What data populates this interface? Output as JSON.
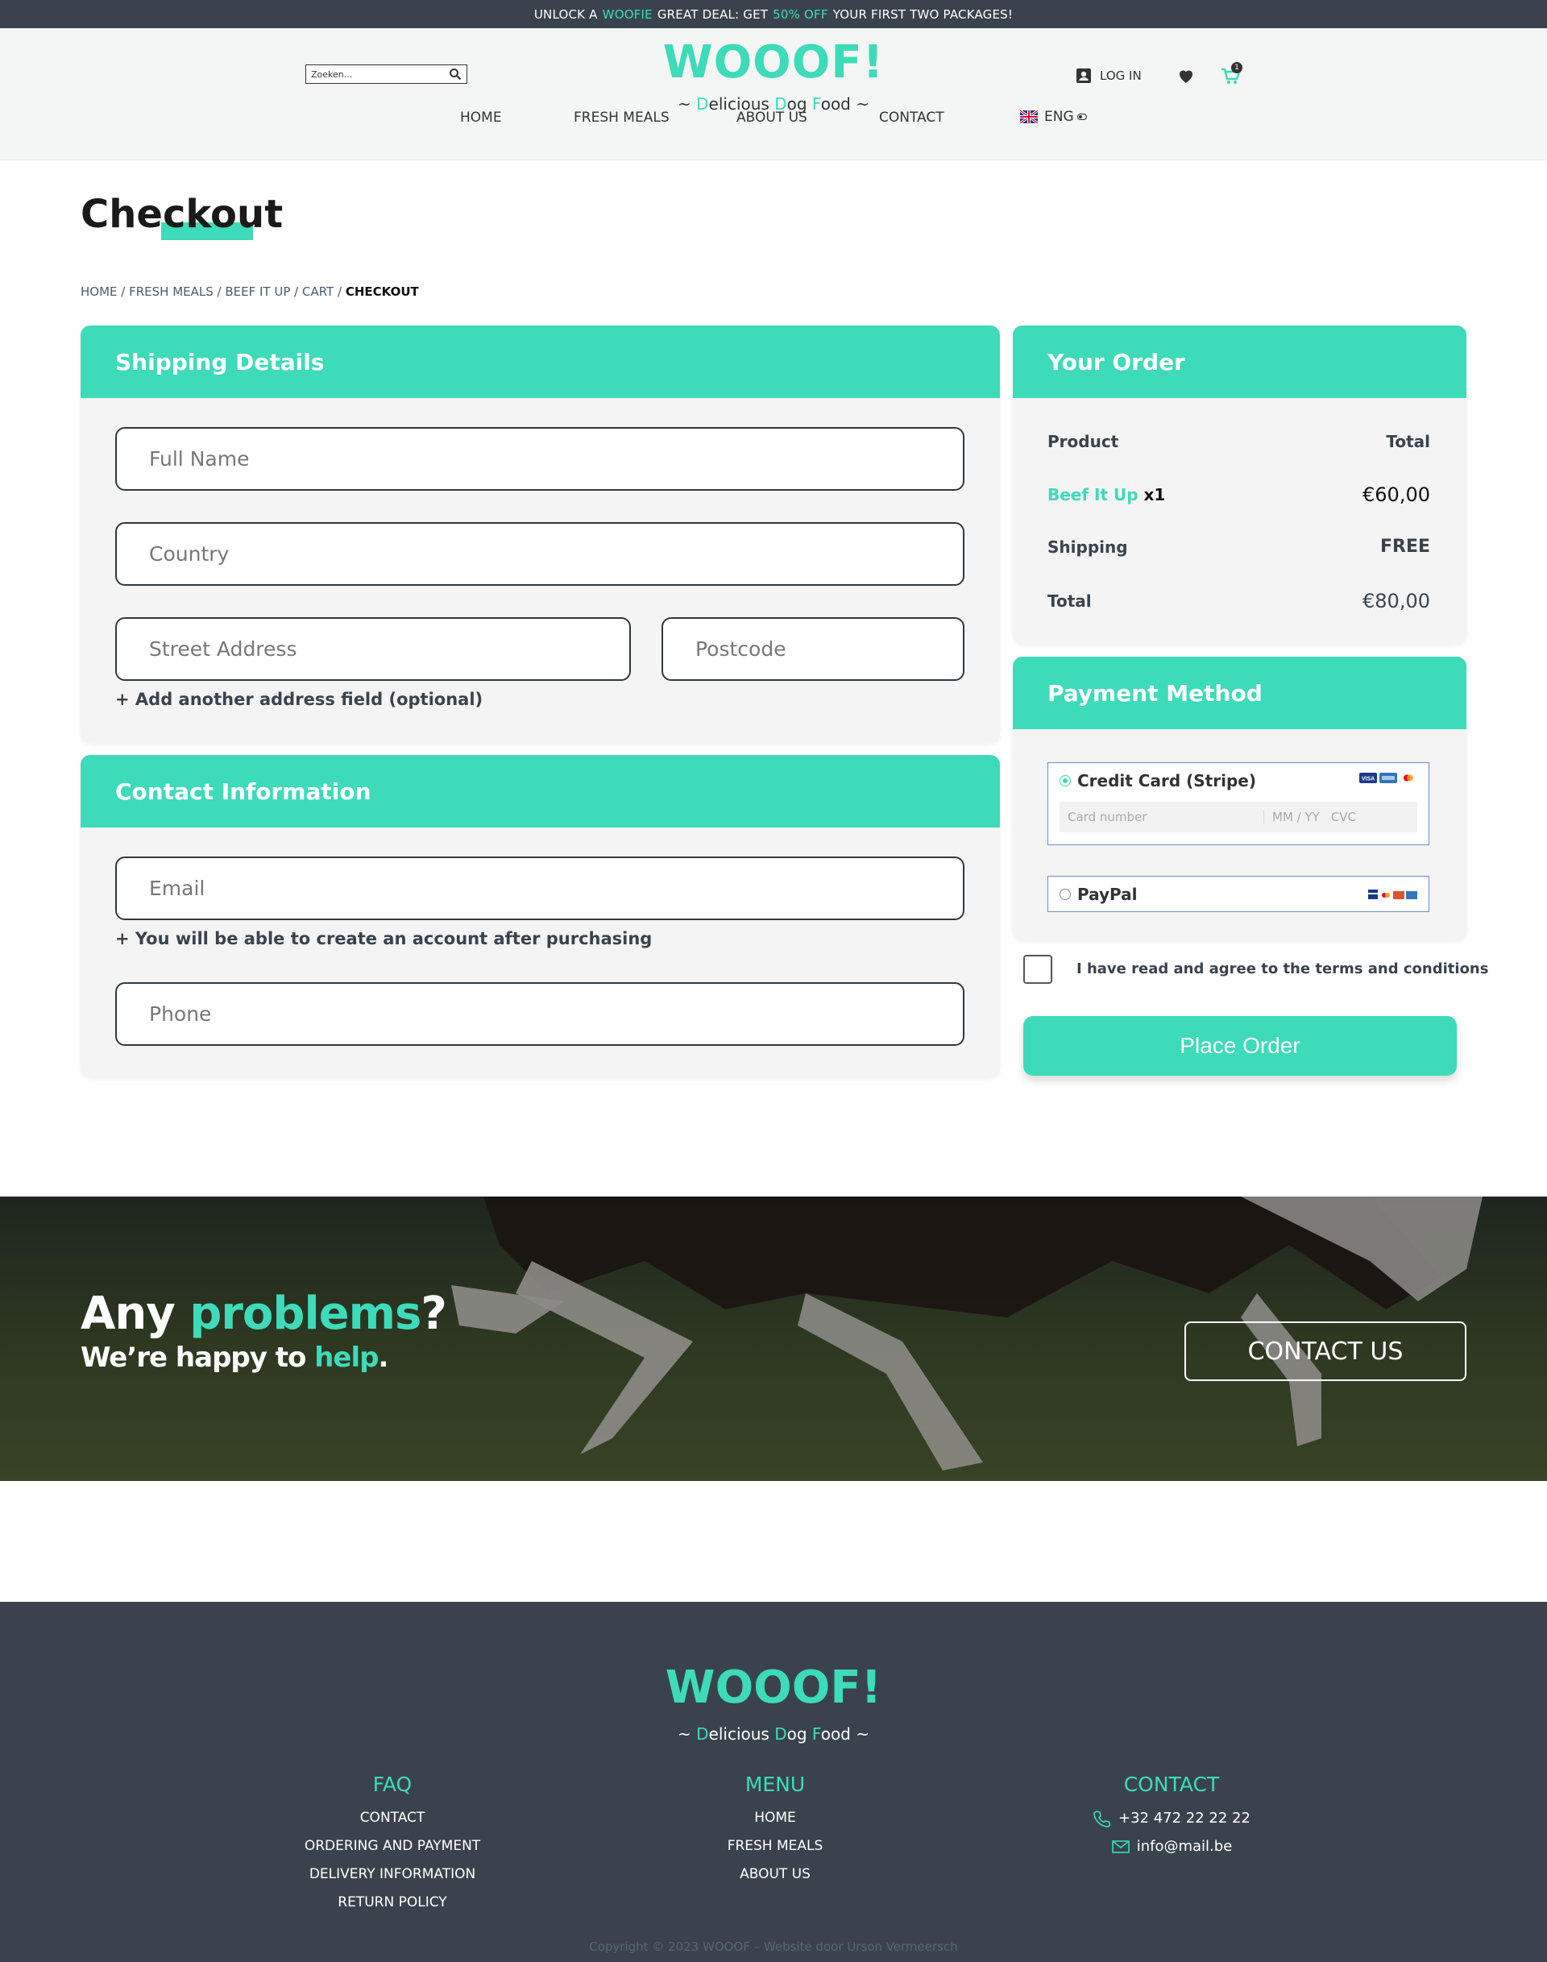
{
  "promo": {
    "part1": "UNLOCK A",
    "part2": "WOOFIE",
    "part3": "GREAT DEAL: GET",
    "part4": "50% OFF",
    "part5": "YOUR FIRST TWO PACKAGES!"
  },
  "header": {
    "logo": "WOOOF!",
    "tagline_parts": [
      "~ ",
      "D",
      "elicious ",
      "D",
      "og ",
      "F",
      "ood ~"
    ],
    "search_placeholder": "Zoeken...",
    "login": "LOG IN",
    "cart_count": "1",
    "lang": "ENG"
  },
  "nav": {
    "items": [
      "HOME",
      "FRESH MEALS",
      "ABOUT US",
      "CONTACT"
    ]
  },
  "page": {
    "title": "Checkout",
    "breadcrumb": [
      "HOME",
      "FRESH MEALS",
      "BEEF IT UP",
      "CART",
      "CHECKOUT"
    ]
  },
  "shipping": {
    "heading": "Shipping Details",
    "full_name": "Full Name",
    "country": "Country",
    "street": "Street Address",
    "postcode": "Postcode",
    "add_field": "+ Add another address field (optional)"
  },
  "contact_info": {
    "heading": "Contact Information",
    "email": "Email",
    "account_hint": "+ You will be able to create an account after purchasing",
    "phone": "Phone"
  },
  "order": {
    "heading": "Your Order",
    "col_product": "Product",
    "col_total": "Total",
    "product_name": "Beef It Up",
    "product_qty": "x1",
    "product_price": "€60,00",
    "shipping_label": "Shipping",
    "shipping_value": "FREE",
    "total_label": "Total",
    "total_value": "€80,00"
  },
  "payment": {
    "heading": "Payment Method",
    "credit_card": "Credit Card (Stripe)",
    "card_number": "Card number",
    "card_expiry": "MM / YY",
    "card_cvc": "CVC",
    "paypal": "PayPal",
    "terms": "I have read and agree to the terms and conditions",
    "place_order": "Place Order"
  },
  "banner": {
    "title_1": "Any ",
    "title_2": "problems",
    "title_3": "?",
    "sub_1": "We’re happy to ",
    "sub_2": "help",
    "sub_3": ".",
    "button": "CONTACT US"
  },
  "footer": {
    "logo": "WOOOF!",
    "faq": {
      "heading": "FAQ",
      "links": [
        "CONTACT",
        "ORDERING AND PAYMENT",
        "DELIVERY INFORMATION",
        "RETURN POLICY"
      ]
    },
    "menu": {
      "heading": "MENU",
      "links": [
        "HOME",
        "FRESH MEALS",
        "ABOUT US"
      ]
    },
    "contact": {
      "heading": "CONTACT",
      "phone": "+32 472 22 22 22",
      "email": "info@mail.be"
    },
    "copyright": "Copyright © 2023 WOOOF –  Website door Urson Vermeersch"
  },
  "colors": {
    "accent": "#3ddbb9",
    "dark": "#3a434d"
  }
}
